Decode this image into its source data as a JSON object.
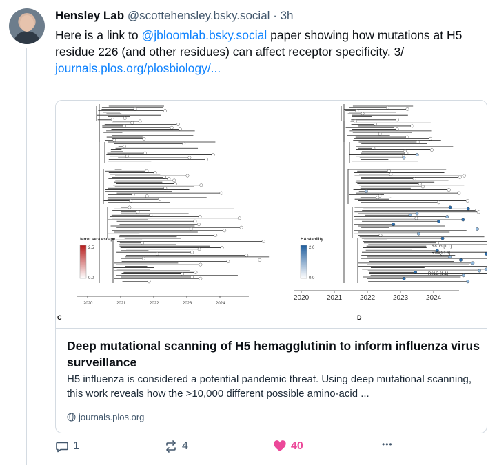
{
  "post": {
    "author_name": "Hensley Lab",
    "author_handle": "@scottehensley.bsky.social",
    "separator": "·",
    "time": "3h",
    "text_before": "Here is a link to ",
    "mention": "@jbloomlab.bsky.social",
    "text_after": " paper showing how mutations at H5 residue 226 (and other residues) can affect receptor specificity. 3/",
    "link_text": "journals.plos.org/plosbiology/..."
  },
  "card": {
    "figure": {
      "left_legend_title": "ferret sera escape",
      "left_legend_max": "2.5",
      "left_legend_min": "0.0",
      "right_legend_title": "HA stability",
      "right_legend_max": "2.0",
      "right_legend_min": "0.0",
      "left_axis_years": [
        "2020",
        "2021",
        "2022",
        "2023",
        "2024"
      ],
      "right_axis_years": [
        "2020",
        "2021",
        "2022",
        "2023",
        "2024"
      ],
      "left_panel_label": "C",
      "right_panel_label": "D",
      "annotations": [
        "R81G [1.1]",
        "R90Q[1.3]",
        "R81G [1.1]"
      ]
    },
    "title": "Deep mutational scanning of H5 hemagglutinin to inform influenza virus surveillance",
    "description": "H5 influenza is considered a potential pandemic threat. Using deep mutational scanning, this work reveals how the >10,000 different possible amino-acid ...",
    "domain": "journals.plos.org"
  },
  "actions": {
    "replies": "1",
    "reposts": "4",
    "likes": "40",
    "more": "•••"
  },
  "colors": {
    "link": "#1083fe",
    "like": "#ec4899",
    "muted": "#42576c",
    "escape_red": "#c0392b",
    "stability_blue": "#2c6fb0"
  }
}
